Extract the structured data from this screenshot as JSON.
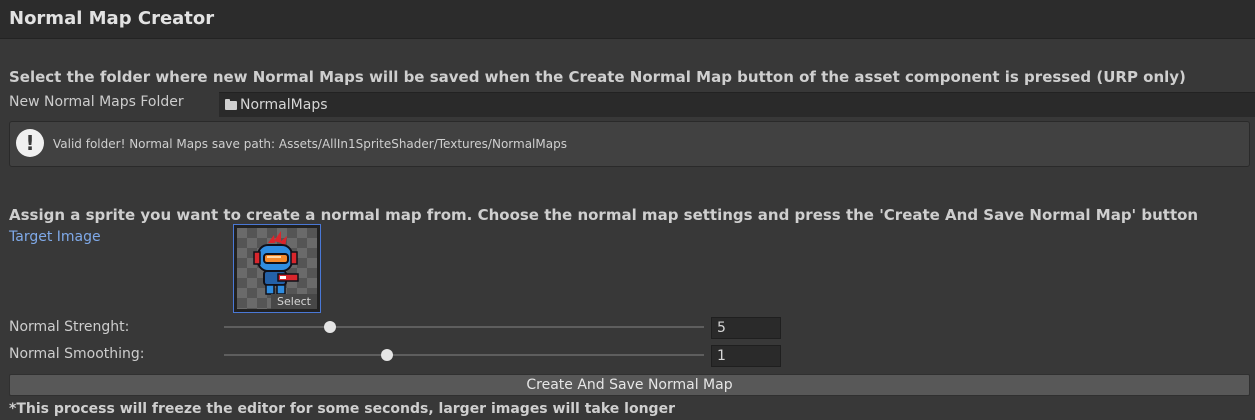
{
  "window": {
    "title": "Normal Map Creator"
  },
  "folder_section": {
    "heading": "Select the folder where new Normal Maps will be saved when the Create Normal Map button of the asset component is pressed (URP only)",
    "field_label": "New Normal Maps Folder",
    "field_value": "NormalMaps",
    "field_icon": "folder-icon",
    "help_icon": "info-exclamation-icon",
    "help_message": "Valid folder! Normal Maps save path: Assets/AllIn1SpriteShader/Textures/NormalMaps"
  },
  "sprite_section": {
    "heading": "Assign a sprite you want to create a normal map from. Choose the normal map settings and press the 'Create And Save Normal Map' button",
    "target_label": "Target Image",
    "select_label": "Select",
    "sprite_name": "robot-character-sprite"
  },
  "settings": {
    "strength": {
      "label": "Normal Strenght:",
      "value": "5",
      "slider_fraction": 0.22
    },
    "smoothing": {
      "label": "Normal Smoothing:",
      "value": "1",
      "slider_fraction": 0.34
    }
  },
  "actions": {
    "create_button": "Create And Save Normal Map"
  },
  "footnote": "*This process will freeze the editor for some seconds, larger images will take longer",
  "colors": {
    "background": "#383838",
    "link_blue": "#7fa9e8",
    "selection_border": "#4a78d6"
  }
}
